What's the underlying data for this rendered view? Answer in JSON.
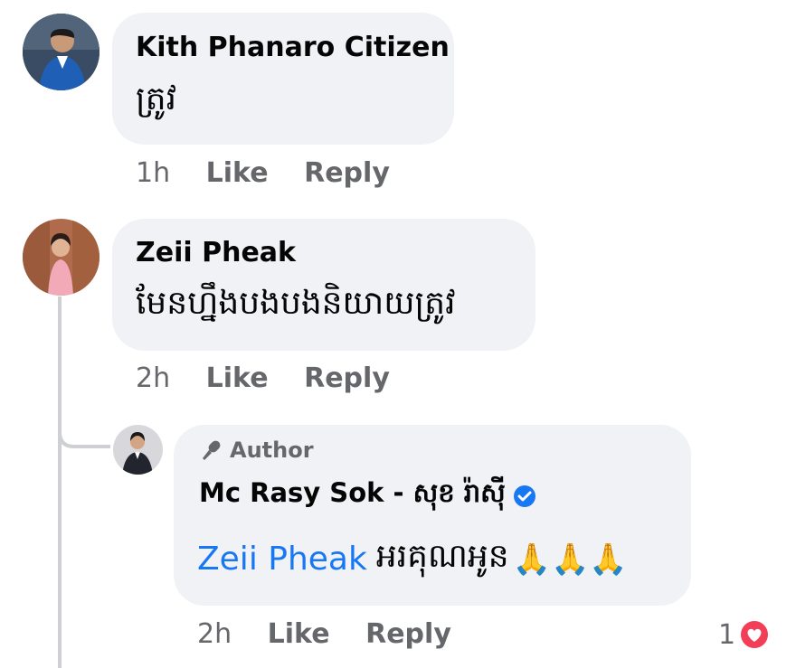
{
  "comments": [
    {
      "author": "Kith Phanaro Citizen",
      "text": "ត្រូវ",
      "time": "1h",
      "like_label": "Like",
      "reply_label": "Reply"
    },
    {
      "author": "Zeii Pheak",
      "text": "មែនហ្នឹងបងបងនិយាយត្រូវ",
      "time": "2h",
      "like_label": "Like",
      "reply_label": "Reply"
    }
  ],
  "reply": {
    "badge_label": "Author",
    "author": "Mc Rasy Sok - សុខ រ៉ាស៊ី",
    "mention": "Zeii Pheak",
    "text": "អរគុណអូន",
    "emoji": "🙏🙏🙏",
    "time": "2h",
    "like_label": "Like",
    "reply_label": "Reply",
    "reaction_count": "1"
  },
  "colors": {
    "bubble": "#f0f2f5",
    "mention": "#1877f2",
    "verified": "#1877f2",
    "heart": "#f33e58",
    "meta": "#65676b"
  }
}
